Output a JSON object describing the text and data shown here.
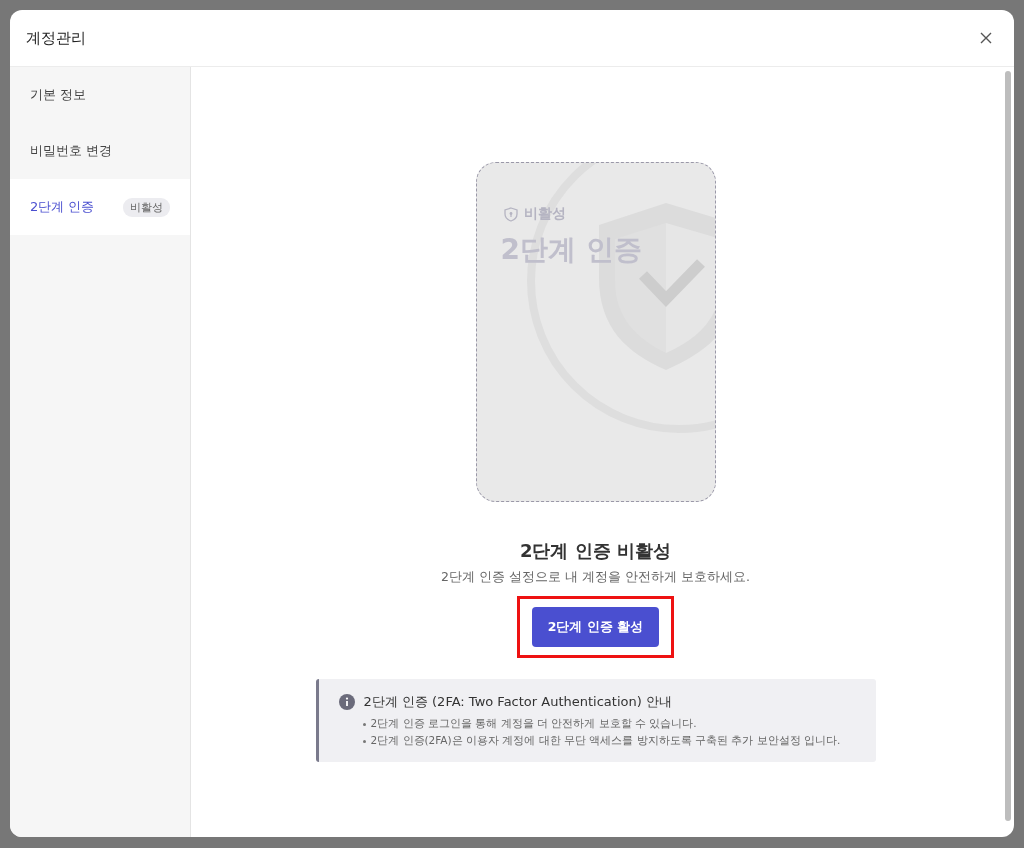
{
  "dialog": {
    "title": "계정관리"
  },
  "sidebar": {
    "items": [
      {
        "label": "기본 정보",
        "selected": false
      },
      {
        "label": "비밀번호 변경",
        "selected": false
      },
      {
        "label": "2단계 인증",
        "selected": true,
        "badge": "비활성"
      }
    ]
  },
  "card": {
    "status": "비활성",
    "title": "2단계 인증"
  },
  "status_title": "2단계 인증 비활성",
  "status_description": "2단계 인증 설정으로 내 계정을 안전하게 보호하세요.",
  "activate_button": {
    "label": "2단계 인증 활성",
    "highlighted": true
  },
  "info": {
    "title": "2단계 인증 (2FA: Two Factor Authentication) 안내",
    "bullets": [
      "2단계 인증 로그인을 통해 계정을 더 안전하게 보호할 수 있습니다.",
      "2단계 인증(2FA)은 이용자 계정에 대한 무단 액세스를 방지하도록 구축된 추가 보안설정 입니다."
    ]
  }
}
